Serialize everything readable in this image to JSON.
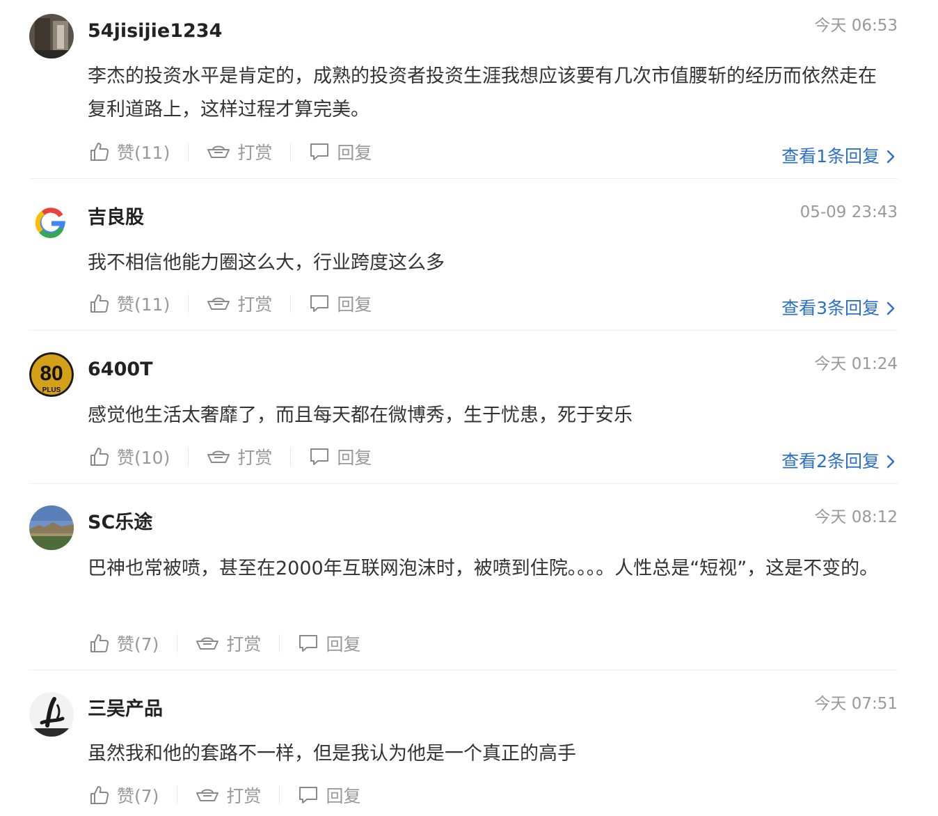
{
  "comments": [
    {
      "username": "54jisijie1234",
      "time": "今天 06:53",
      "content": "李杰的投资水平是肯定的，成熟的投资者投资生涯我想应该要有几次市值腰斩的经历而依然走在复利道路上，这样过程才算完美。",
      "like_label": "赞(11)",
      "tip_label": "打赏",
      "reply_label": "回复",
      "view_replies": "查看1条回复"
    },
    {
      "username": "吉良股",
      "time": "05-09 23:43",
      "content": "我不相信他能力圈这么大，行业跨度这么多",
      "like_label": "赞(11)",
      "tip_label": "打赏",
      "reply_label": "回复",
      "view_replies": "查看3条回复"
    },
    {
      "username": "6400T",
      "time": "今天 01:24",
      "content": "感觉他生活太奢靡了，而且每天都在微博秀，生于忧患，死于安乐",
      "like_label": "赞(10)",
      "tip_label": "打赏",
      "reply_label": "回复",
      "view_replies": "查看2条回复"
    },
    {
      "username": "SC乐途",
      "time": "今天 08:12",
      "content": "巴神也常被喷，甚至在2000年互联网泡沫时，被喷到住院。。。。人性总是“短视”，这是不变的。",
      "like_label": "赞(7)",
      "tip_label": "打赏",
      "reply_label": "回复"
    },
    {
      "username": "三吴产品",
      "time": "今天 07:51",
      "content": "虽然我和他的套路不一样，但是我认为他是一个真正的高手",
      "like_label": "赞(7)",
      "tip_label": "打赏",
      "reply_label": "回复"
    }
  ],
  "avatars": {
    "c2_letter": "G",
    "c3_number": "80",
    "c3_sub": "PLUS"
  },
  "icons": {
    "like": "thumbs-up-icon",
    "tip": "ingot-tip-icon",
    "reply": "speech-bubble-icon",
    "more": "chevron-right-icon"
  },
  "colors": {
    "link": "#2a6fc9",
    "muted": "#999999",
    "text": "#333333",
    "username": "#222222"
  }
}
